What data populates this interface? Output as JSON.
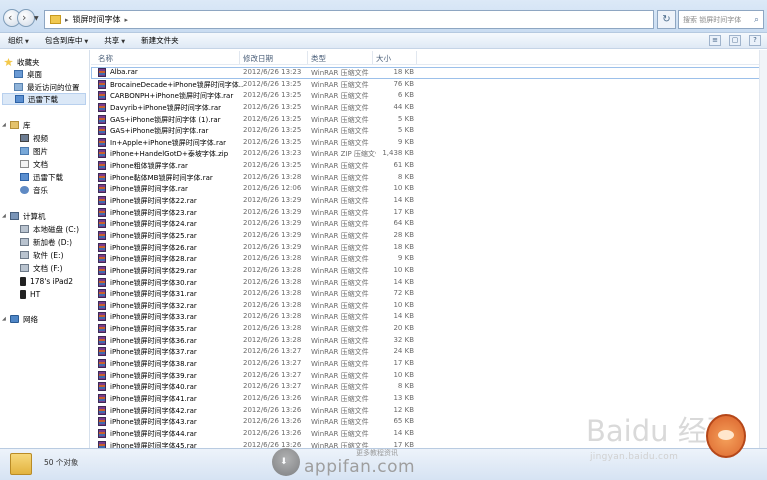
{
  "window": {
    "address_path": "锁屏时间字体",
    "search_placeholder": "搜索 锁屏时间字体"
  },
  "toolbar": {
    "organize": "组织",
    "include_in_library": "包含到库中",
    "share": "共享",
    "new_folder": "新建文件夹"
  },
  "nav": {
    "favorites": "收藏夹",
    "desktop": "桌面",
    "recent": "最近访问的位置",
    "downloads": "迅雷下载",
    "libraries": "库",
    "videos": "视频",
    "pictures": "图片",
    "documents": "文档",
    "lib_downloads": "迅雷下载",
    "music": "音乐",
    "computer": "计算机",
    "drive_c": "本地磁盘 (C:)",
    "drive_d": "新加卷 (D:)",
    "drive_e": "软件 (E:)",
    "drive_f": "文档 (F:)",
    "ipad": "178's iPad2",
    "ht": "HT",
    "network": "网络"
  },
  "columns": {
    "name": "名称",
    "date": "修改日期",
    "type": "类型",
    "size": "大小"
  },
  "files": [
    {
      "name": "Alba.rar",
      "date": "2012/6/26 13:23",
      "type": "WinRAR 压缩文件",
      "size": "18 KB"
    },
    {
      "name": "BrocaineDecade+iPhone锁屏时间字体...",
      "date": "2012/6/26 13:25",
      "type": "WinRAR 压缩文件",
      "size": "76 KB"
    },
    {
      "name": "CARBONPH+iPhone锁屏时间字体.rar",
      "date": "2012/6/26 13:25",
      "type": "WinRAR 压缩文件",
      "size": "6 KB"
    },
    {
      "name": "Davyrib+iPhone锁屏时间字体.rar",
      "date": "2012/6/26 13:25",
      "type": "WinRAR 压缩文件",
      "size": "44 KB"
    },
    {
      "name": "GAS+iPhone锁屏时间字体 (1).rar",
      "date": "2012/6/26 13:25",
      "type": "WinRAR 压缩文件",
      "size": "5 KB"
    },
    {
      "name": "GAS+iPhone锁屏时间字体.rar",
      "date": "2012/6/26 13:25",
      "type": "WinRAR 压缩文件",
      "size": "5 KB"
    },
    {
      "name": "In+Apple+iPhone锁屏时间字体.rar",
      "date": "2012/6/26 13:25",
      "type": "WinRAR 压缩文件",
      "size": "9 KB"
    },
    {
      "name": "iPhone+HandelGotD+泰坡字体.zip",
      "date": "2012/6/26 13:23",
      "type": "WinRAR ZIP 压缩文件",
      "size": "1,438 KB"
    },
    {
      "name": "iPhone粗体锁屏字体.rar",
      "date": "2012/6/26 13:25",
      "type": "WinRAR 压缩文件",
      "size": "61 KB"
    },
    {
      "name": "iPhone黏体MB锁屏时间字体.rar",
      "date": "2012/6/26 13:28",
      "type": "WinRAR 压缩文件",
      "size": "8 KB"
    },
    {
      "name": "iPhone锁屏时间字体.rar",
      "date": "2012/6/26 12:06",
      "type": "WinRAR 压缩文件",
      "size": "10 KB"
    },
    {
      "name": "iPhone锁屏时间字体22.rar",
      "date": "2012/6/26 13:29",
      "type": "WinRAR 压缩文件",
      "size": "14 KB"
    },
    {
      "name": "iPhone锁屏时间字体23.rar",
      "date": "2012/6/26 13:29",
      "type": "WinRAR 压缩文件",
      "size": "17 KB"
    },
    {
      "name": "iPhone锁屏时间字体24.rar",
      "date": "2012/6/26 13:29",
      "type": "WinRAR 压缩文件",
      "size": "64 KB"
    },
    {
      "name": "iPhone锁屏时间字体25.rar",
      "date": "2012/6/26 13:29",
      "type": "WinRAR 压缩文件",
      "size": "28 KB"
    },
    {
      "name": "iPhone锁屏时间字体26.rar",
      "date": "2012/6/26 13:29",
      "type": "WinRAR 压缩文件",
      "size": "18 KB"
    },
    {
      "name": "iPhone锁屏时间字体28.rar",
      "date": "2012/6/26 13:28",
      "type": "WinRAR 压缩文件",
      "size": "9 KB"
    },
    {
      "name": "iPhone锁屏时间字体29.rar",
      "date": "2012/6/26 13:28",
      "type": "WinRAR 压缩文件",
      "size": "10 KB"
    },
    {
      "name": "iPhone锁屏时间字体30.rar",
      "date": "2012/6/26 13:28",
      "type": "WinRAR 压缩文件",
      "size": "14 KB"
    },
    {
      "name": "iPhone锁屏时间字体31.rar",
      "date": "2012/6/26 13:28",
      "type": "WinRAR 压缩文件",
      "size": "72 KB"
    },
    {
      "name": "iPhone锁屏时间字体32.rar",
      "date": "2012/6/26 13:28",
      "type": "WinRAR 压缩文件",
      "size": "10 KB"
    },
    {
      "name": "iPhone锁屏时间字体33.rar",
      "date": "2012/6/26 13:28",
      "type": "WinRAR 压缩文件",
      "size": "14 KB"
    },
    {
      "name": "iPhone锁屏时间字体35.rar",
      "date": "2012/6/26 13:28",
      "type": "WinRAR 压缩文件",
      "size": "20 KB"
    },
    {
      "name": "iPhone锁屏时间字体36.rar",
      "date": "2012/6/26 13:28",
      "type": "WinRAR 压缩文件",
      "size": "32 KB"
    },
    {
      "name": "iPhone锁屏时间字体37.rar",
      "date": "2012/6/26 13:27",
      "type": "WinRAR 压缩文件",
      "size": "24 KB"
    },
    {
      "name": "iPhone锁屏时间字体38.rar",
      "date": "2012/6/26 13:27",
      "type": "WinRAR 压缩文件",
      "size": "17 KB"
    },
    {
      "name": "iPhone锁屏时间字体39.rar",
      "date": "2012/6/26 13:27",
      "type": "WinRAR 压缩文件",
      "size": "10 KB"
    },
    {
      "name": "iPhone锁屏时间字体40.rar",
      "date": "2012/6/26 13:27",
      "type": "WinRAR 压缩文件",
      "size": "8 KB"
    },
    {
      "name": "iPhone锁屏时间字体41.rar",
      "date": "2012/6/26 13:26",
      "type": "WinRAR 压缩文件",
      "size": "13 KB"
    },
    {
      "name": "iPhone锁屏时间字体42.rar",
      "date": "2012/6/26 13:26",
      "type": "WinRAR 压缩文件",
      "size": "12 KB"
    },
    {
      "name": "iPhone锁屏时间字体43.rar",
      "date": "2012/6/26 13:26",
      "type": "WinRAR 压缩文件",
      "size": "65 KB"
    },
    {
      "name": "iPhone锁屏时间字体44.rar",
      "date": "2012/6/26 13:26",
      "type": "WinRAR 压缩文件",
      "size": "14 KB"
    },
    {
      "name": "iPhone锁屏时间字体45.rar",
      "date": "2012/6/26 13:26",
      "type": "WinRAR 压缩文件",
      "size": "17 KB"
    }
  ],
  "status": {
    "item_count": "50 个对象"
  },
  "watermarks": {
    "center_top": "更多教程资讯",
    "center_brand": "appifan.com",
    "baidu_logo": "Baidu 经验",
    "baidu_url": "jingyan.baidu.com"
  }
}
